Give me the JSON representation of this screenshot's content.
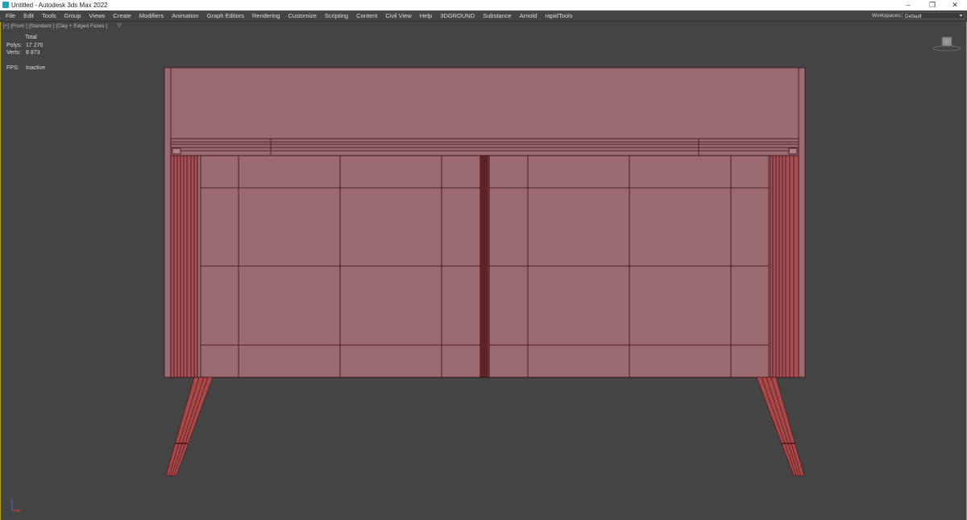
{
  "window": {
    "title": "Untitled - Autodesk 3ds Max 2022",
    "controls": {
      "minimize": "–",
      "restore": "❐",
      "close": "✕"
    }
  },
  "menu": {
    "items": [
      "File",
      "Edit",
      "Tools",
      "Group",
      "Views",
      "Create",
      "Modifiers",
      "Animation",
      "Graph Editors",
      "Rendering",
      "Customize",
      "Scripting",
      "Content",
      "Civil View",
      "Help",
      "3DGROUND",
      "Substance",
      "Arnold",
      "rapidTools"
    ],
    "workspaces_label": "Workspaces:",
    "workspace_value": "Default"
  },
  "viewport": {
    "label": "[+] [Front ] [Standard ] [Clay + Edged Faces ]",
    "filter_icon": "filter-icon",
    "stats": {
      "header": "Total",
      "polys_label": "Polys:",
      "polys_value": "17 270",
      "verts_label": "Verts:",
      "verts_value": "8 873",
      "fps_label": "FPS:",
      "fps_value": "Inactive"
    }
  },
  "colors": {
    "viewport_bg": "#444444",
    "model_fill": "#9b6a6e",
    "wire": "#4a1a1e",
    "leg": "#a24a4a",
    "active_border": "#b8a000"
  }
}
